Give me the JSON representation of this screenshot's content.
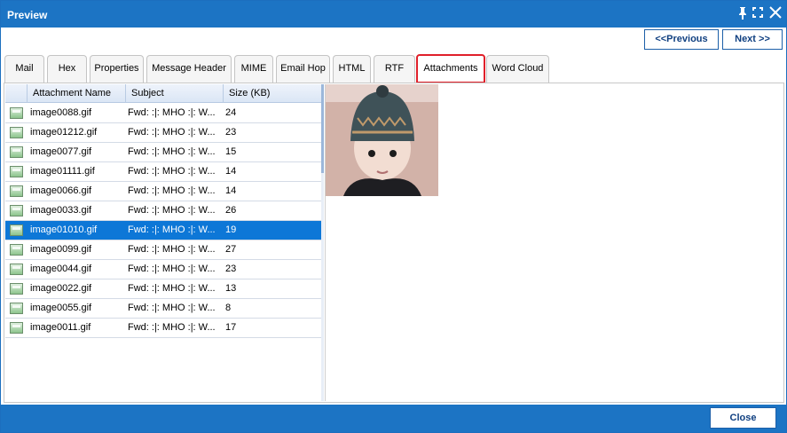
{
  "window": {
    "title": "Preview"
  },
  "titlebar_icons": [
    "pin-icon",
    "maximize-icon",
    "close-icon"
  ],
  "nav": {
    "previous_label": "<<Previous",
    "next_label": "Next >>"
  },
  "tabs": [
    {
      "label": "Mail",
      "active": false
    },
    {
      "label": "Hex",
      "active": false
    },
    {
      "label": "Properties",
      "active": false
    },
    {
      "label": "Message Header",
      "active": false
    },
    {
      "label": "MIME",
      "active": false
    },
    {
      "label": "Email Hop",
      "active": false
    },
    {
      "label": "HTML",
      "active": false
    },
    {
      "label": "RTF",
      "active": false
    },
    {
      "label": "Attachments",
      "active": true
    },
    {
      "label": "Word Cloud",
      "active": false
    }
  ],
  "table": {
    "columns": [
      "Attachment Name",
      "Subject",
      "Size (KB)"
    ],
    "rows": [
      {
        "name": "image0088.gif",
        "subject": "Fwd: :|: MHO :|: W...",
        "size": "24",
        "selected": false
      },
      {
        "name": "image01212.gif",
        "subject": "Fwd: :|: MHO :|: W...",
        "size": "23",
        "selected": false
      },
      {
        "name": "image0077.gif",
        "subject": "Fwd: :|: MHO :|: W...",
        "size": "15",
        "selected": false
      },
      {
        "name": "image01111.gif",
        "subject": "Fwd: :|: MHO :|: W...",
        "size": "14",
        "selected": false
      },
      {
        "name": "image0066.gif",
        "subject": "Fwd: :|: MHO :|: W...",
        "size": "14",
        "selected": false
      },
      {
        "name": "image0033.gif",
        "subject": "Fwd: :|: MHO :|: W...",
        "size": "26",
        "selected": false
      },
      {
        "name": "image01010.gif",
        "subject": "Fwd: :|: MHO :|: W...",
        "size": "19",
        "selected": true
      },
      {
        "name": "image0099.gif",
        "subject": "Fwd: :|: MHO :|: W...",
        "size": "27",
        "selected": false
      },
      {
        "name": "image0044.gif",
        "subject": "Fwd: :|: MHO :|: W...",
        "size": "23",
        "selected": false
      },
      {
        "name": "image0022.gif",
        "subject": "Fwd: :|: MHO :|: W...",
        "size": "13",
        "selected": false
      },
      {
        "name": "image0055.gif",
        "subject": "Fwd: :|: MHO :|: W...",
        "size": "8",
        "selected": false
      },
      {
        "name": "image0011.gif",
        "subject": "Fwd: :|: MHO :|: W...",
        "size": "17",
        "selected": false
      }
    ]
  },
  "footer": {
    "close_label": "Close"
  },
  "colors": {
    "accent": "#1c74c4",
    "selected_row": "#0d77d7",
    "active_tab_border": "#e0202a"
  }
}
